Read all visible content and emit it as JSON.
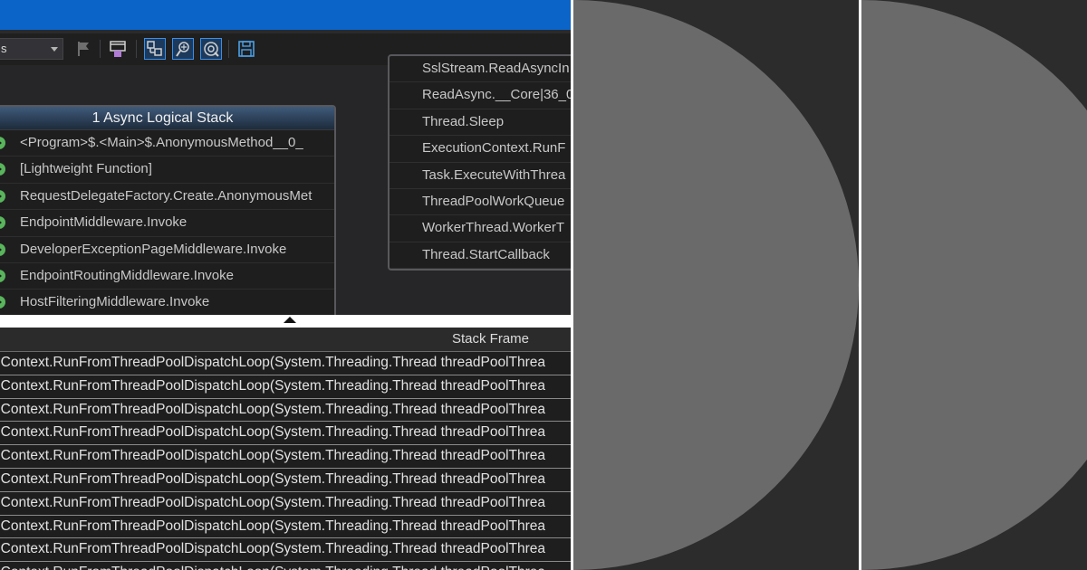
{
  "toolbar": {
    "combo_value": "s"
  },
  "async_stack": {
    "title": "1 Async Logical Stack",
    "frames": [
      "<Program>$.<Main>$.AnonymousMethod__0_",
      "[Lightweight Function]",
      "RequestDelegateFactory.Create.AnonymousMet",
      "EndpointMiddleware.Invoke",
      "DeveloperExceptionPageMiddleware.Invoke",
      "EndpointRoutingMiddleware.Invoke",
      "HostFilteringMiddleware.Invoke"
    ]
  },
  "thread_stack": {
    "frames": [
      "SslStream.ReadAsyncIn",
      "ReadAsync.__Core|36_0",
      "Thread.Sleep",
      "ExecutionContext.RunF",
      "Task.ExecuteWithThrea",
      "ThreadPoolWorkQueue",
      "WorkerThread.WorkerT",
      "Thread.StartCallback"
    ]
  },
  "stack_grid": {
    "header": "Stack Frame",
    "rows": [
      "ionContext.RunFromThreadPoolDispatchLoop(System.Threading.Thread threadPoolThrea",
      "ionContext.RunFromThreadPoolDispatchLoop(System.Threading.Thread threadPoolThrea",
      "ionContext.RunFromThreadPoolDispatchLoop(System.Threading.Thread threadPoolThrea",
      "ionContext.RunFromThreadPoolDispatchLoop(System.Threading.Thread threadPoolThrea",
      "ionContext.RunFromThreadPoolDispatchLoop(System.Threading.Thread threadPoolThrea",
      "ionContext.RunFromThreadPoolDispatchLoop(System.Threading.Thread threadPoolThrea",
      "ionContext.RunFromThreadPoolDispatchLoop(System.Threading.Thread threadPoolThrea",
      "ionContext.RunFromThreadPoolDispatchLoop(System.Threading.Thread threadPoolThrea",
      "ionContext.RunFromThreadPoolDispatchLoop(System.Threading.Thread threadPoolThrea",
      "ionContext.RunFromThreadPoolDispatchLoop(System.Threading.Thread threadPoolThrea"
    ]
  },
  "icons": [
    "dropdown-arrow-icon",
    "flag-icon",
    "show-external-code-icon",
    "toggle-method-view-icon",
    "auto-scroll-icon",
    "zoom-to-current-frame-icon",
    "save-icon",
    "frame-arrow-icon"
  ],
  "colors": {
    "title_bar": "#0b64c8",
    "background": "#1f1f1f",
    "frame_icon": "#59b55c",
    "selected_tool": "#3b8ee8",
    "decor_circle": "#6a6a6a"
  }
}
